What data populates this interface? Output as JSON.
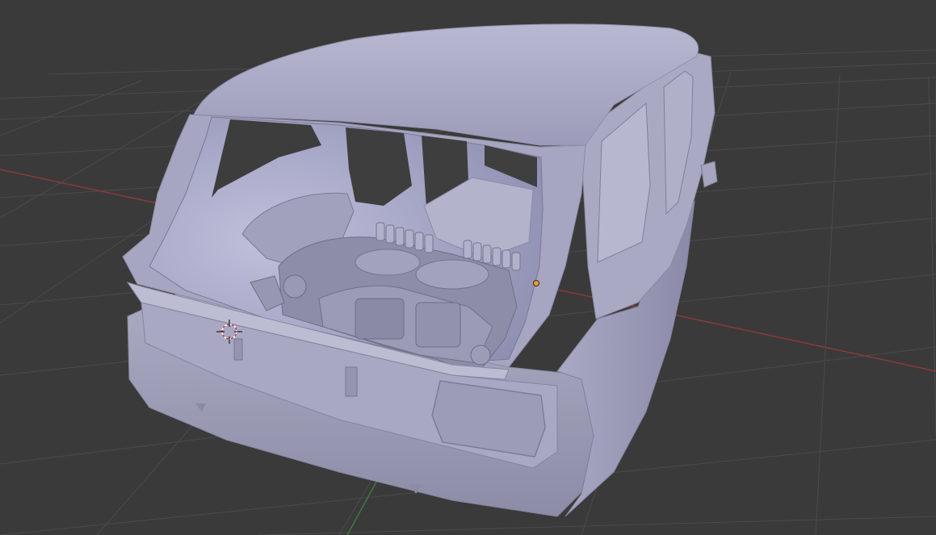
{
  "viewport": {
    "background_color": "#3a3a3a",
    "grid_color": "#4a4a4a",
    "x_axis_color": "#8b3a3a",
    "y_axis_color": "#3e7a3e",
    "model_color": "#a7a7c3",
    "shading": "solid",
    "objects": [
      {
        "name": "car-body-model",
        "icon": "mesh-object"
      },
      {
        "name": "3d-cursor",
        "icon": "crosshair-icon"
      },
      {
        "name": "object-origin",
        "icon": "origin-dot-icon"
      }
    ]
  }
}
